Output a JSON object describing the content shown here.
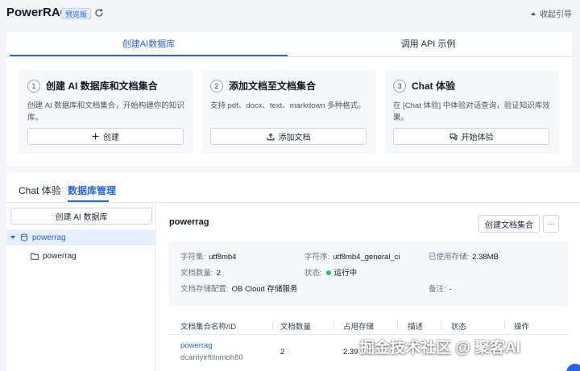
{
  "header": {
    "brand": "PowerRAG",
    "badge": "预览版",
    "collapse_label": "收起引导"
  },
  "guide": {
    "tabs": [
      {
        "label": "创建AI数据库",
        "active": true
      },
      {
        "label": "调用 API 示例",
        "active": false
      }
    ],
    "steps": [
      {
        "num": "1",
        "title": "创建 AI 数据库和文档集合",
        "desc": "创建 AI 数据库和文档集合，开始构建你的知识库。",
        "button": "创建",
        "icon": "plus-icon"
      },
      {
        "num": "2",
        "title": "添加文档至文档集合",
        "desc": "支持 pdf、docx、text、markdown 多种格式。",
        "button": "添加文档",
        "icon": "upload-icon"
      },
      {
        "num": "3",
        "title": "Chat 体验",
        "desc": "在 [Chat 体验] 中体验对话查询，验证知识库效果。",
        "button": "开始体验",
        "icon": "chat-icon"
      }
    ]
  },
  "panel": {
    "tabs": [
      {
        "label": "Chat 体验",
        "active": false
      },
      {
        "label": "数据库管理",
        "active": true
      }
    ],
    "sidebar": {
      "create_button": "创建 AI 数据库",
      "tree": [
        {
          "label": "powerrag",
          "level": 0,
          "selected": true,
          "icon": "database-icon"
        },
        {
          "label": "powerrag",
          "level": 1,
          "selected": false,
          "icon": "folder-icon"
        }
      ]
    },
    "main": {
      "title": "powerrag",
      "create_set_button": "创建文档集合",
      "more_button": "···",
      "info": {
        "charset_label": "字符集:",
        "charset": "utf8mb4",
        "collation_label": "字符序:",
        "collation": "utf8mb4_general_ci",
        "used_label": "已使用存储:",
        "used": "2.38MB",
        "doc_count_label": "文档数量:",
        "doc_count": "2",
        "status_label": "状态:",
        "status": "运行中",
        "storage_label": "文档存储配置:",
        "storage": "OB Cloud 存储服务",
        "remark_label": "备注:",
        "remark": "-"
      },
      "table": {
        "columns": [
          "文档集合名称/ID",
          "文档数量",
          "占用存储",
          "描述",
          "状态",
          "操作"
        ],
        "rows": [
          {
            "name": "powerrag",
            "id": "dcarrlyirftllnmoh80",
            "count": "2",
            "size": "2.39"
          }
        ]
      }
    }
  },
  "watermark": "掘金技术社区 @ 聚客AI",
  "colors": {
    "accent": "#2563eb",
    "status_ok": "#22c55e"
  }
}
